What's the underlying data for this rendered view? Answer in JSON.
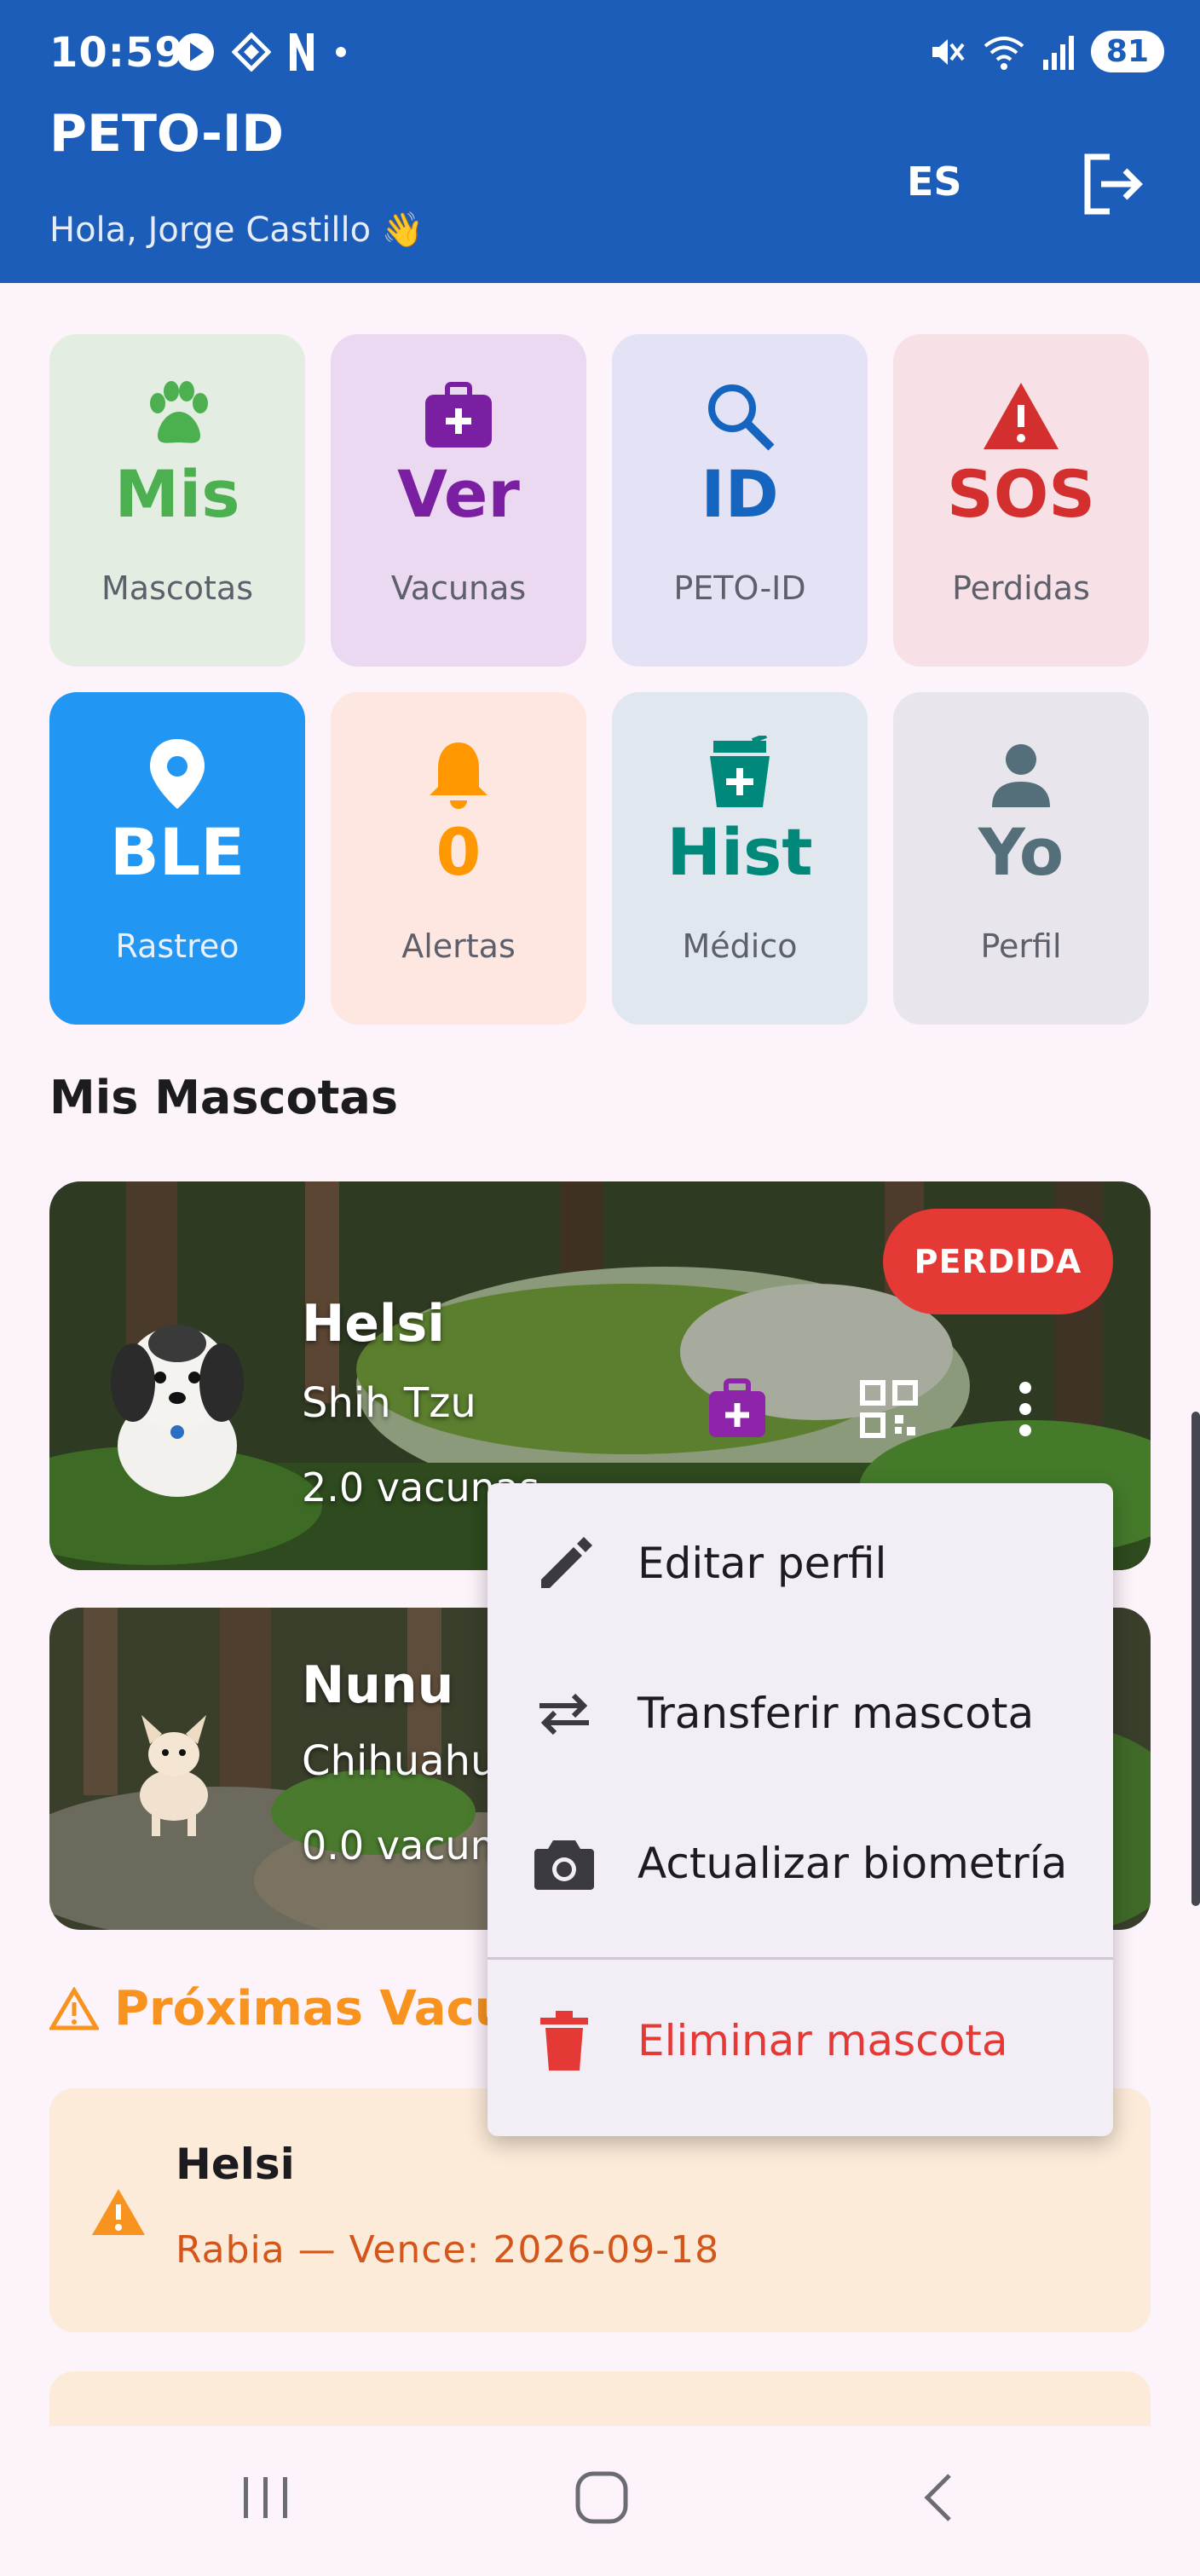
{
  "status_bar": {
    "time": "10:59",
    "battery": "81"
  },
  "header": {
    "title": "PETO-ID",
    "greeting": "Hola, Jorge Castillo 👋",
    "language": "ES"
  },
  "grid": [
    {
      "big": "Mis",
      "small": "Mascotas",
      "icon": "paw-icon",
      "color": "#4caf50",
      "bg": "#e4ede2"
    },
    {
      "big": "Ver",
      "small": "Vacunas",
      "icon": "medical-kit-icon",
      "color": "#7b1fa2",
      "bg": "#ead9f0"
    },
    {
      "big": "ID",
      "small": "PETO-ID",
      "icon": "search-icon",
      "color": "#1565c0",
      "bg": "#e3e3f5"
    },
    {
      "big": "SOS",
      "small": "Perdidas",
      "icon": "warning-icon",
      "color": "#d32f2f",
      "bg": "#f8e1e6"
    },
    {
      "big": "BLE",
      "small": "Rastreo",
      "icon": "location-pin-icon",
      "color": "#ffffff",
      "bg": "#2196f3"
    },
    {
      "big": "0",
      "small": "Alertas",
      "icon": "bell-icon",
      "color": "#ff9800",
      "bg": "#fde7e0"
    },
    {
      "big": "Hist",
      "small": "Médico",
      "icon": "medical-history-icon",
      "color": "#00897b",
      "bg": "#e1e7ef"
    },
    {
      "big": "Yo",
      "small": "Perfil",
      "icon": "person-icon",
      "color": "#546e7a",
      "bg": "#e8e6ec"
    }
  ],
  "section_title": "Mis Mascotas",
  "pets": [
    {
      "name": "Helsi",
      "breed": "Shih Tzu",
      "vaccines": "2.0 vacunas",
      "badge": "PERDIDA"
    },
    {
      "name": "Nunu",
      "breed": "Chihuahua",
      "vaccines": "0.0 vacunas"
    }
  ],
  "menu": {
    "items": [
      {
        "label": "Editar perfil",
        "icon": "edit-icon"
      },
      {
        "label": "Transferir mascota",
        "icon": "transfer-icon"
      },
      {
        "label": "Actualizar biometría",
        "icon": "camera-icon"
      },
      {
        "label": "Eliminar mascota",
        "icon": "delete-icon",
        "color": "#e53935"
      }
    ]
  },
  "upcoming": {
    "title": "Próximas Vacunas",
    "items": [
      {
        "pet": "Helsi",
        "info": "Rabia — Vence: 2026-09-18"
      }
    ]
  }
}
